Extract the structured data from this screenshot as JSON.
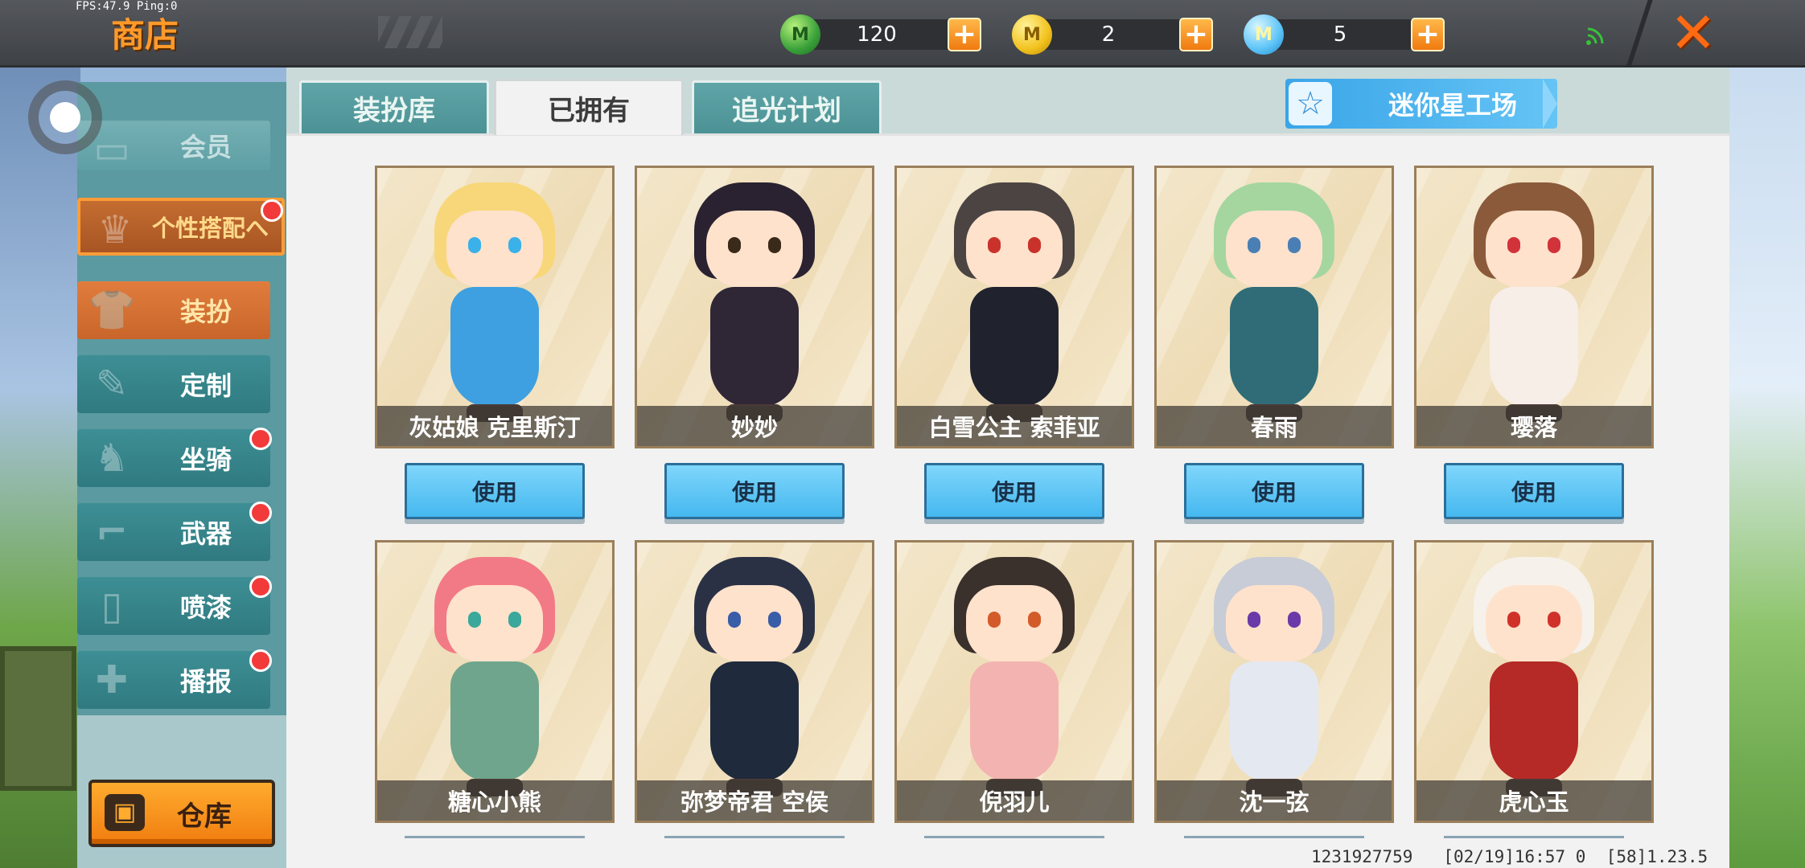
{
  "status": {
    "fps": "FPS:47.9",
    "ping": "Ping:0"
  },
  "header": {
    "title": "商店",
    "currencies": [
      {
        "amount": "120",
        "icon": "green-gem-coin-icon"
      },
      {
        "amount": "2",
        "icon": "gold-coin-icon"
      },
      {
        "amount": "5",
        "icon": "blue-coin-icon"
      }
    ],
    "close": "✕"
  },
  "sidebar": {
    "member": "会员",
    "personal_match": "个性搭配へ",
    "items": [
      {
        "label": "装扮",
        "active": true,
        "badge": false
      },
      {
        "label": "定制",
        "active": false,
        "badge": false
      },
      {
        "label": "坐骑",
        "active": false,
        "badge": true
      },
      {
        "label": "武器",
        "active": false,
        "badge": true
      },
      {
        "label": "喷漆",
        "active": false,
        "badge": true
      },
      {
        "label": "播报",
        "active": false,
        "badge": true
      }
    ],
    "warehouse": "仓库"
  },
  "tabs": [
    "装扮库",
    "已拥有",
    "追光计划"
  ],
  "active_tab": "已拥有",
  "workshop_button": "迷你星工场",
  "use_label": "使用",
  "outfits": [
    {
      "name": "灰姑娘 克里斯汀",
      "hair": "#f7d77a",
      "body": "#3ea0e0",
      "eye": "#3ab1e8"
    },
    {
      "name": "妙妙",
      "hair": "#2a2230",
      "body": "#2f2636",
      "eye": "#3a2a1a"
    },
    {
      "name": "白雪公主 索菲亚",
      "hair": "#4b4442",
      "body": "#20232e",
      "eye": "#c9322a"
    },
    {
      "name": "春雨",
      "hair": "#a5d6a0",
      "body": "#2f6c78",
      "eye": "#4a7fb5"
    },
    {
      "name": "璎落",
      "hair": "#8a5a3a",
      "body": "#f7eee8",
      "eye": "#d2323a"
    },
    {
      "name": "糖心小熊",
      "hair": "#f27a86",
      "body": "#6fa58c",
      "eye": "#3aa89a"
    },
    {
      "name": "弥梦帝君 空侯",
      "hair": "#2b3145",
      "body": "#1f2a3c",
      "eye": "#3a5da8"
    },
    {
      "name": "倪羽儿",
      "hair": "#3a302c",
      "body": "#f3b3b0",
      "eye": "#d35b2a"
    },
    {
      "name": "沈一弦",
      "hair": "#c8ccd6",
      "body": "#e4e8f0",
      "eye": "#6a3aa8"
    },
    {
      "name": "虎心玉",
      "hair": "#f6f1ea",
      "body": "#b52a26",
      "eye": "#d0322a"
    }
  ],
  "footer": {
    "id": "1231927759",
    "time": "[02/19]16:57 0",
    "version": "[58]1.23.5"
  },
  "colors": {
    "accent_orange": "#ff9a2a",
    "teal": "#4c9295",
    "use_blue": "#45b8ef",
    "badge_red": "#f23a3a"
  }
}
